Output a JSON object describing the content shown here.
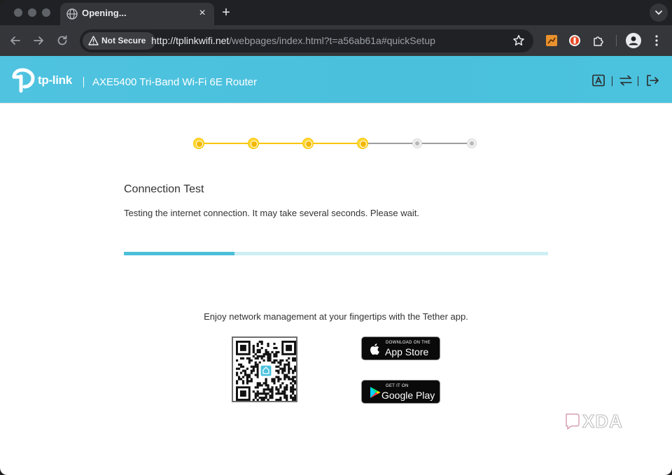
{
  "browser": {
    "tab_title": "Opening...",
    "tab_close": "×",
    "new_tab": "+",
    "security_label": "Not Secure",
    "url_host": "http://tplinkwifi.net",
    "url_path": "/webpages/index.html?t=a56ab61a#quickSetup"
  },
  "router": {
    "brand": "tp-link",
    "model": "AXE5400 Tri-Band Wi-Fi 6E Router",
    "accent_color": "#4bc2de"
  },
  "wizard": {
    "steps_total": 6,
    "steps_completed": 4,
    "title": "Connection Test",
    "description": "Testing the internet connection. It may take several seconds. Please wait.",
    "progress_fraction": 0.26
  },
  "tether": {
    "text": "Enjoy network management at your fingertips with the Tether app.",
    "app_store_small": "DOWNLOAD ON THE",
    "app_store_big": "App Store",
    "google_play_small": "GET IT ON",
    "google_play_big": "Google Play"
  },
  "watermark": "XDA"
}
